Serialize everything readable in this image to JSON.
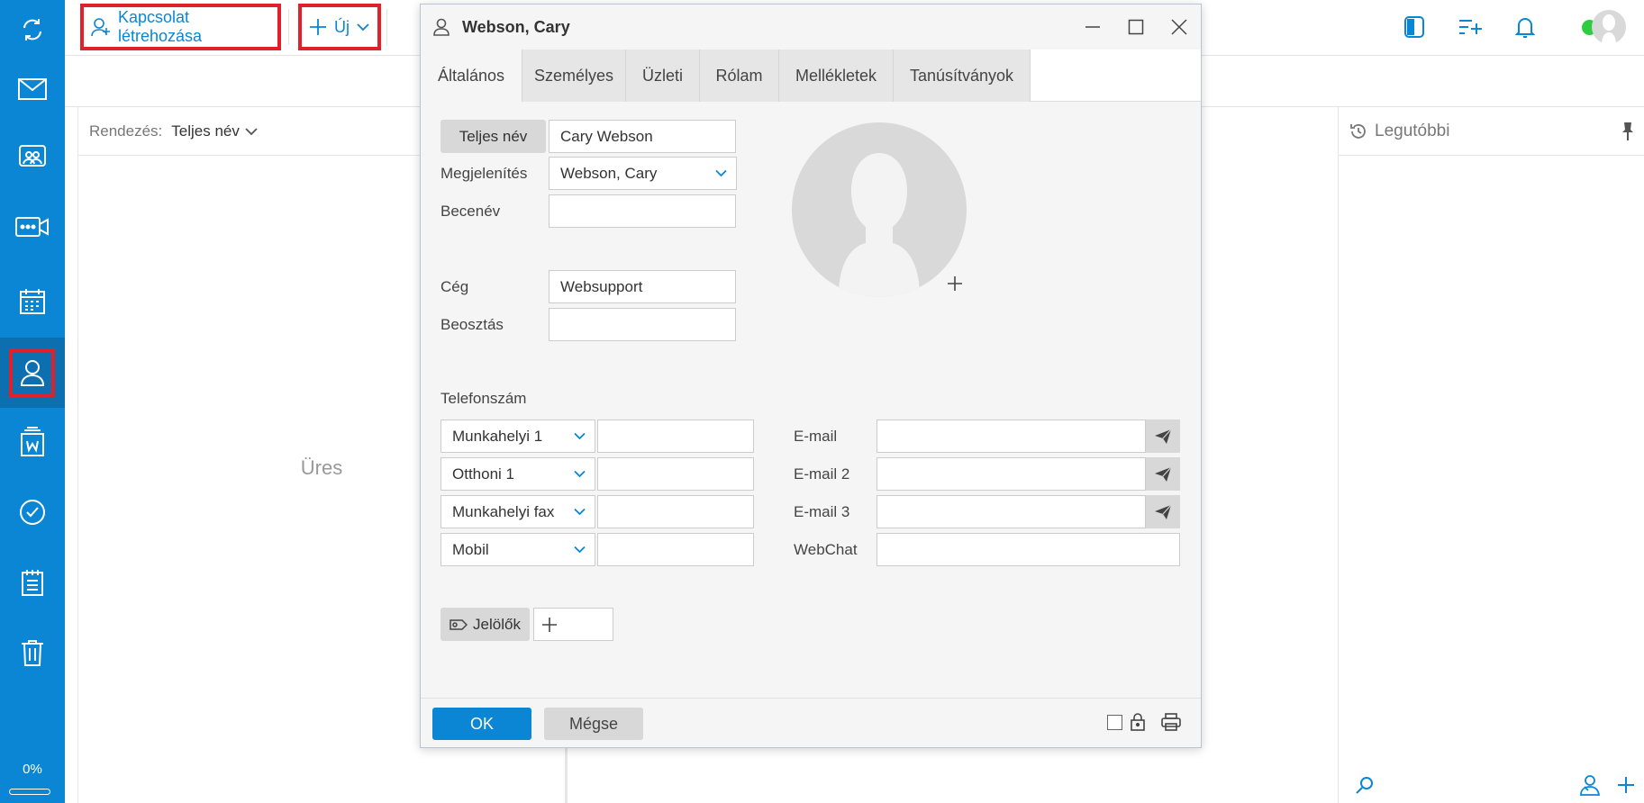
{
  "sidebar": {
    "items": [
      {
        "name": "sync-icon"
      },
      {
        "name": "mail-icon"
      },
      {
        "name": "chat-icon"
      },
      {
        "name": "video-icon"
      },
      {
        "name": "calendar-icon"
      },
      {
        "name": "contacts-icon"
      },
      {
        "name": "documents-icon"
      },
      {
        "name": "tasks-icon"
      },
      {
        "name": "notes-icon"
      },
      {
        "name": "trash-icon"
      }
    ],
    "progress_label": "0%",
    "progress_value": 0
  },
  "toolbar": {
    "create_contact_label": "Kapcsolat létrehozása",
    "new_label": "Új"
  },
  "list": {
    "sort_label": "Rendezés:",
    "sort_value": "Teljes név",
    "empty_label": "Üres"
  },
  "right_panel": {
    "title": "Legutóbbi"
  },
  "dialog": {
    "title": "Webson, Cary",
    "tabs": [
      "Általános",
      "Személyes",
      "Üzleti",
      "Rólam",
      "Mellékletek",
      "Tanúsítványok"
    ],
    "fullname_button": "Teljes név",
    "fullname_value": "Cary Webson",
    "display_label": "Megjelenítés",
    "display_value": "Webson, Cary",
    "nickname_label": "Becenév",
    "nickname_value": "",
    "company_label": "Cég",
    "company_value": "Websupport",
    "position_label": "Beosztás",
    "position_value": "",
    "phone_section": "Telefonszám",
    "phones": [
      {
        "type": "Munkahelyi 1",
        "value": ""
      },
      {
        "type": "Otthoni 1",
        "value": ""
      },
      {
        "type": "Munkahelyi fax",
        "value": ""
      },
      {
        "type": "Mobil",
        "value": ""
      }
    ],
    "emails": [
      {
        "label": "E-mail",
        "value": ""
      },
      {
        "label": "E-mail 2",
        "value": ""
      },
      {
        "label": "E-mail 3",
        "value": ""
      }
    ],
    "webchat_label": "WebChat",
    "webchat_value": "",
    "tags_label": "Jelölők",
    "ok_label": "OK",
    "cancel_label": "Mégse"
  },
  "colors": {
    "accent": "#0a86d4",
    "highlight": "#e0202a",
    "status_online": "#2ecc40"
  }
}
